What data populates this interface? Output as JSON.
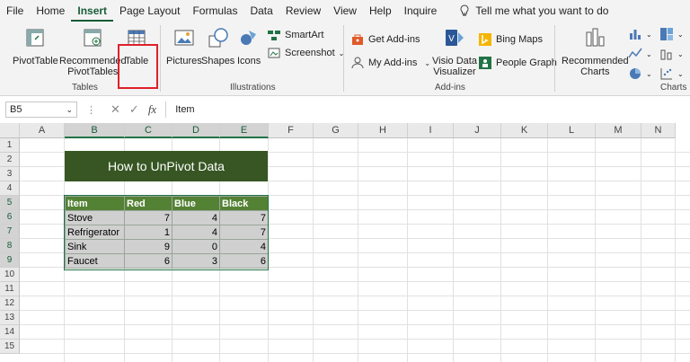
{
  "menu": {
    "items": [
      "File",
      "Home",
      "Insert",
      "Page Layout",
      "Formulas",
      "Data",
      "Review",
      "View",
      "Help",
      "Inquire"
    ],
    "active": "Insert",
    "tell_me": "Tell me what you want to do"
  },
  "ribbon": {
    "tables": {
      "pivottable": "PivotTable",
      "recommended_pivottables_1": "Recommended",
      "recommended_pivottables_2": "PivotTables",
      "table": "Table",
      "group_label": "Tables"
    },
    "illustrations": {
      "pictures": "Pictures",
      "shapes": "Shapes",
      "icons": "Icons",
      "smartart": "SmartArt",
      "screenshot": "Screenshot",
      "group_label": "Illustrations"
    },
    "addins": {
      "get_addins": "Get Add-ins",
      "my_addins": "My Add-ins",
      "visio_1": "Visio Data",
      "visio_2": "Visualizer",
      "bing_maps": "Bing Maps",
      "people_graph": "People Graph",
      "group_label": "Add-ins"
    },
    "charts": {
      "recommended_1": "Recommended",
      "recommended_2": "Charts",
      "group_label": "Charts"
    }
  },
  "formula_bar": {
    "name_box": "B5",
    "fx": "fx",
    "value": "Item"
  },
  "sheet": {
    "columns": [
      "A",
      "B",
      "C",
      "D",
      "E",
      "F",
      "G",
      "H",
      "I",
      "J",
      "K",
      "L",
      "M",
      "N"
    ],
    "rows": [
      "1",
      "2",
      "3",
      "4",
      "5",
      "6",
      "7",
      "8",
      "9",
      "10",
      "11",
      "12",
      "13",
      "14",
      "15"
    ],
    "title": "How to UnPivot Data",
    "table": {
      "headers": [
        "Item",
        "Red",
        "Blue",
        "Black"
      ],
      "rows": [
        [
          "Stove",
          "7",
          "4",
          "7"
        ],
        [
          "Refrigerator",
          "1",
          "4",
          "7"
        ],
        [
          "Sink",
          "9",
          "0",
          "4"
        ],
        [
          "Faucet",
          "6",
          "3",
          "6"
        ]
      ]
    }
  },
  "colors": {
    "accent": "#217346",
    "title_fill": "#375623",
    "header_fill": "#548235",
    "body_fill": "#d0d0d0",
    "highlight": "#e0202a"
  }
}
